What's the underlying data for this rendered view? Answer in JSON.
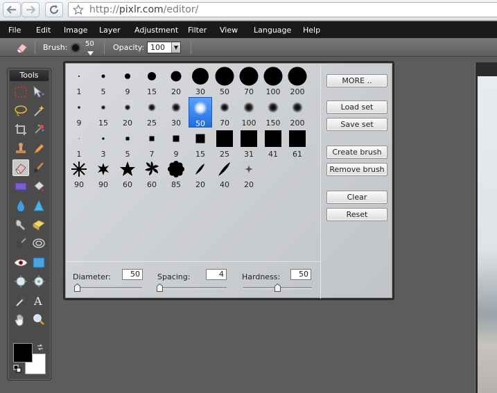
{
  "browser": {
    "url_prefix": "http://",
    "url_domain": "pixlr.com",
    "url_path": "/editor/"
  },
  "menu": [
    "File",
    "Edit",
    "Image",
    "Layer",
    "Adjustment",
    "Filter",
    "View",
    "Language",
    "Help"
  ],
  "options": {
    "brush_label": "Brush:",
    "brush_size": "50",
    "opacity_label": "Opacity:",
    "opacity_value": "100"
  },
  "tools": {
    "title": "Tools",
    "items": [
      "marquee-icon",
      "move-icon",
      "lasso-icon",
      "wand-icon",
      "crop-icon",
      "sparkle-icon",
      "stamp-icon",
      "pencil-icon",
      "eraser-icon",
      "brush-icon",
      "rect-icon",
      "bucket-icon",
      "drop-icon",
      "cone-icon",
      "smudge-icon",
      "sponge-icon",
      "burn-icon",
      "eye-icon",
      "redeye-icon",
      "frame-icon",
      "spot-icon",
      "bloat-icon",
      "picker-icon",
      "text-icon",
      "hand-icon",
      "zoom-icon"
    ],
    "active": "eraser-icon",
    "foreground_color": "#000000",
    "background_color": "#ffffff"
  },
  "brush_panel": {
    "rows": [
      {
        "type": "hard",
        "sizes": [
          "1",
          "5",
          "9",
          "15",
          "20",
          "30",
          "50",
          "70",
          "100",
          "200"
        ]
      },
      {
        "type": "soft",
        "sizes": [
          "9",
          "15",
          "20",
          "25",
          "30",
          "50",
          "70",
          "100",
          "150",
          "200"
        ]
      },
      {
        "type": "square",
        "sizes": [
          "1",
          "3",
          "5",
          "7",
          "9",
          "15",
          "25",
          "31",
          "41",
          "61"
        ]
      },
      {
        "type": "shape",
        "sizes": [
          "90",
          "90",
          "60",
          "60",
          "85",
          "20",
          "40",
          "20"
        ]
      }
    ],
    "selected": "50",
    "buttons": {
      "more": "MORE ..",
      "load_set": "Load set",
      "save_set": "Save set",
      "create_brush": "Create brush",
      "remove_brush": "Remove brush",
      "clear": "Clear",
      "reset": "Reset"
    },
    "params": {
      "diameter_label": "Diameter:",
      "diameter_value": "50",
      "spacing_label": "Spacing:",
      "spacing_value": "4",
      "hardness_label": "Hardness:",
      "hardness_value": "50"
    }
  }
}
